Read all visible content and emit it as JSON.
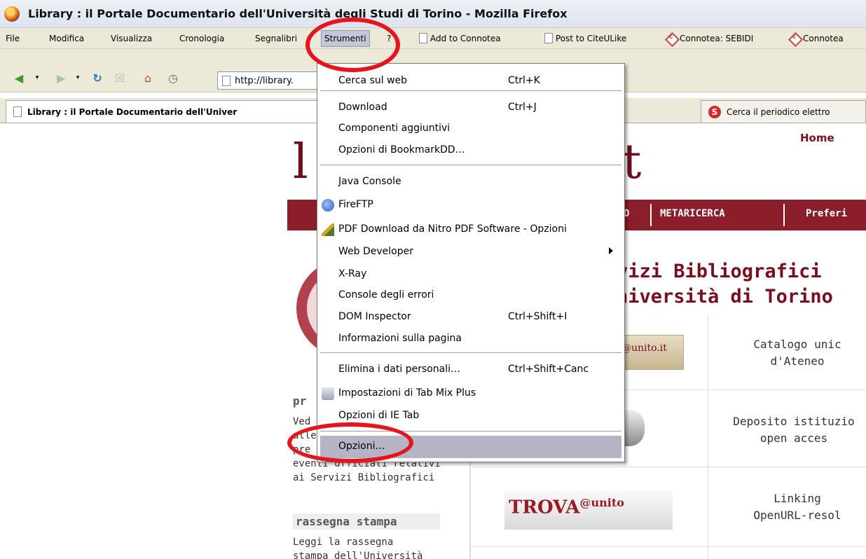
{
  "window": {
    "title": "Library : il Portale Documentario dell'Università degli Studi di Torino - Mozilla Firefox"
  },
  "menubar": {
    "items": [
      "File",
      "Modifica",
      "Visualizza",
      "Cronologia",
      "Segnalibri",
      "Strumenti",
      "?"
    ],
    "bookmarks": [
      "Add to Connotea",
      "Post to CiteULike",
      "Connotea: SEBIDI",
      "Connotea"
    ]
  },
  "navbar": {
    "url": "http://library."
  },
  "tabs": [
    "Library : il Portale Documentario dell'Univer",
    "Cerca il periodico elettro"
  ],
  "page": {
    "logo_left": "l",
    "logo_right": "t",
    "home": "Home",
    "nav": [
      "O",
      "METARICERCA",
      "Preferi"
    ],
    "heading_line1": "vizi Bibliografici",
    "heading_line2": "niversità di Torino",
    "services": [
      {
        "line1": "Catalogo unic",
        "line2": "d'Ateneo"
      },
      {
        "line1": "Deposito istituzio",
        "line2": "open acces"
      },
      {
        "line1": "Linking",
        "line2": "OpenURL-resol"
      }
    ],
    "unito_img": "@unito.it",
    "trova_main": "TROVA",
    "trova_sup": "@unito",
    "side_heading1": "pr",
    "side_text1": [
      "Ved",
      "alle",
      "pre",
      "eventi ufficiali relativi",
      "ai Servizi Bibliografici"
    ],
    "side_heading2": "rassegna stampa",
    "side_text2": [
      "Leggi la rassegna",
      "stampa dell'Università"
    ]
  },
  "menu": {
    "items": [
      {
        "label": "Cerca sul web",
        "shortcut": "Ctrl+K"
      },
      {
        "label": "Download",
        "shortcut": "Ctrl+J"
      },
      {
        "label": "Componenti aggiuntivi",
        "shortcut": ""
      },
      {
        "label": "Opzioni di BookmarkDD…",
        "shortcut": ""
      },
      {
        "label": "Java Console",
        "shortcut": ""
      },
      {
        "label": "FireFTP",
        "shortcut": ""
      },
      {
        "label": "PDF Download da Nitro PDF Software - Opzioni",
        "shortcut": ""
      },
      {
        "label": "Web Developer",
        "shortcut": ""
      },
      {
        "label": "X-Ray",
        "shortcut": ""
      },
      {
        "label": "Console degli errori",
        "shortcut": ""
      },
      {
        "label": "DOM Inspector",
        "shortcut": "Ctrl+Shift+I"
      },
      {
        "label": "Informazioni sulla pagina",
        "shortcut": ""
      },
      {
        "label": "Elimina i dati personali…",
        "shortcut": "Ctrl+Shift+Canc"
      },
      {
        "label": "Impostazioni di Tab Mix Plus",
        "shortcut": ""
      },
      {
        "label": "Opzioni di IE Tab",
        "shortcut": ""
      },
      {
        "label": "Opzioni…",
        "shortcut": ""
      }
    ],
    "highlighted": "Opzioni…"
  },
  "colors": {
    "brand": "#8c1d2a",
    "annotation": "#e8141c",
    "menu_highlight": "#b4b4c4"
  }
}
